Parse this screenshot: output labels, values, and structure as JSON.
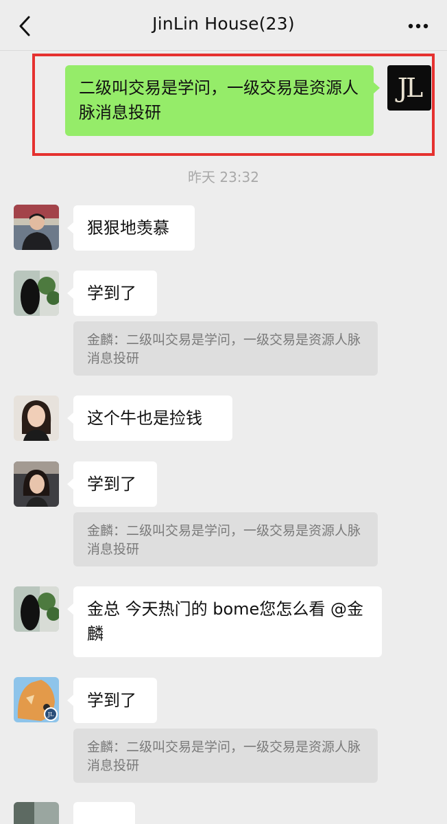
{
  "header": {
    "title": "JinLin House(23)"
  },
  "messages": {
    "own": {
      "text": "二级叫交易是学问，一级交易是资源人脉消息投研",
      "avatar_text": "JL"
    },
    "timestamp": "昨天 23:32",
    "m1": {
      "text": "狠狠地羡慕"
    },
    "m2": {
      "text": "学到了",
      "quote": "金麟：二级叫交易是学问，一级交易是资源人脉消息投研"
    },
    "m3": {
      "text": "这个牛也是捡钱"
    },
    "m4": {
      "text": "学到了",
      "quote": "金麟：二级叫交易是学问，一级交易是资源人脉消息投研"
    },
    "m5": {
      "text": "金总 今天热门的 bome您怎么看 @金麟"
    },
    "m6": {
      "text": "学到了",
      "quote": "金麟：二级叫交易是学问，一级交易是资源人脉消息投研",
      "badge": "JL"
    }
  },
  "colors": {
    "own_bubble": "#95ec69",
    "highlight": "#e5312f",
    "background": "#ededed"
  }
}
